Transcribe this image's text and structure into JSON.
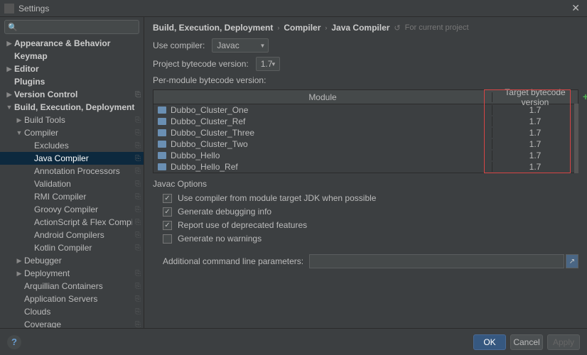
{
  "titlebar": {
    "title": "Settings"
  },
  "search": {
    "placeholder": ""
  },
  "sidebar": [
    {
      "label": "Appearance & Behavior",
      "bold": true,
      "arrow": "▶",
      "indent": 0,
      "badge": false
    },
    {
      "label": "Keymap",
      "bold": true,
      "arrow": "",
      "indent": 0,
      "badge": false
    },
    {
      "label": "Editor",
      "bold": true,
      "arrow": "▶",
      "indent": 0,
      "badge": false
    },
    {
      "label": "Plugins",
      "bold": true,
      "arrow": "",
      "indent": 0,
      "badge": false
    },
    {
      "label": "Version Control",
      "bold": true,
      "arrow": "▶",
      "indent": 0,
      "badge": true
    },
    {
      "label": "Build, Execution, Deployment",
      "bold": true,
      "arrow": "▼",
      "indent": 0,
      "badge": false
    },
    {
      "label": "Build Tools",
      "bold": false,
      "arrow": "▶",
      "indent": 1,
      "badge": true
    },
    {
      "label": "Compiler",
      "bold": false,
      "arrow": "▼",
      "indent": 1,
      "badge": true
    },
    {
      "label": "Excludes",
      "bold": false,
      "arrow": "",
      "indent": 2,
      "badge": true
    },
    {
      "label": "Java Compiler",
      "bold": false,
      "arrow": "",
      "indent": 2,
      "badge": true,
      "selected": true
    },
    {
      "label": "Annotation Processors",
      "bold": false,
      "arrow": "",
      "indent": 2,
      "badge": true
    },
    {
      "label": "Validation",
      "bold": false,
      "arrow": "",
      "indent": 2,
      "badge": true
    },
    {
      "label": "RMI Compiler",
      "bold": false,
      "arrow": "",
      "indent": 2,
      "badge": true
    },
    {
      "label": "Groovy Compiler",
      "bold": false,
      "arrow": "",
      "indent": 2,
      "badge": true
    },
    {
      "label": "ActionScript & Flex Compiler",
      "bold": false,
      "arrow": "",
      "indent": 2,
      "badge": true
    },
    {
      "label": "Android Compilers",
      "bold": false,
      "arrow": "",
      "indent": 2,
      "badge": true
    },
    {
      "label": "Kotlin Compiler",
      "bold": false,
      "arrow": "",
      "indent": 2,
      "badge": true
    },
    {
      "label": "Debugger",
      "bold": false,
      "arrow": "▶",
      "indent": 1,
      "badge": false
    },
    {
      "label": "Deployment",
      "bold": false,
      "arrow": "▶",
      "indent": 1,
      "badge": true
    },
    {
      "label": "Arquillian Containers",
      "bold": false,
      "arrow": "",
      "indent": 1,
      "badge": true
    },
    {
      "label": "Application Servers",
      "bold": false,
      "arrow": "",
      "indent": 1,
      "badge": true
    },
    {
      "label": "Clouds",
      "bold": false,
      "arrow": "",
      "indent": 1,
      "badge": true
    },
    {
      "label": "Coverage",
      "bold": false,
      "arrow": "",
      "indent": 1,
      "badge": true
    }
  ],
  "breadcrumb": {
    "bc1": "Build, Execution, Deployment",
    "bc2": "Compiler",
    "bc3": "Java Compiler",
    "scope": "For current project"
  },
  "form": {
    "use_compiler_label": "Use compiler:",
    "use_compiler_value": "Javac",
    "project_bytecode_label": "Project bytecode version:",
    "project_bytecode_value": "1.7",
    "per_module_label": "Per-module bytecode version:"
  },
  "table": {
    "col_module": "Module",
    "col_target": "Target bytecode version",
    "rows": [
      {
        "module": "Dubbo_Cluster_One",
        "target": "1.7"
      },
      {
        "module": "Dubbo_Cluster_Ref",
        "target": "1.7"
      },
      {
        "module": "Dubbo_Cluster_Three",
        "target": "1.7"
      },
      {
        "module": "Dubbo_Cluster_Two",
        "target": "1.7"
      },
      {
        "module": "Dubbo_Hello",
        "target": "1.7"
      },
      {
        "module": "Dubbo_Hello_Ref",
        "target": "1.7"
      }
    ]
  },
  "javac": {
    "section": "Javac Options",
    "cb1": "Use compiler from module target JDK when possible",
    "cb2": "Generate debugging info",
    "cb3": "Report use of deprecated features",
    "cb4": "Generate no warnings",
    "cmdline_label": "Additional command line parameters:"
  },
  "footer": {
    "ok": "OK",
    "cancel": "Cancel",
    "apply": "Apply"
  }
}
